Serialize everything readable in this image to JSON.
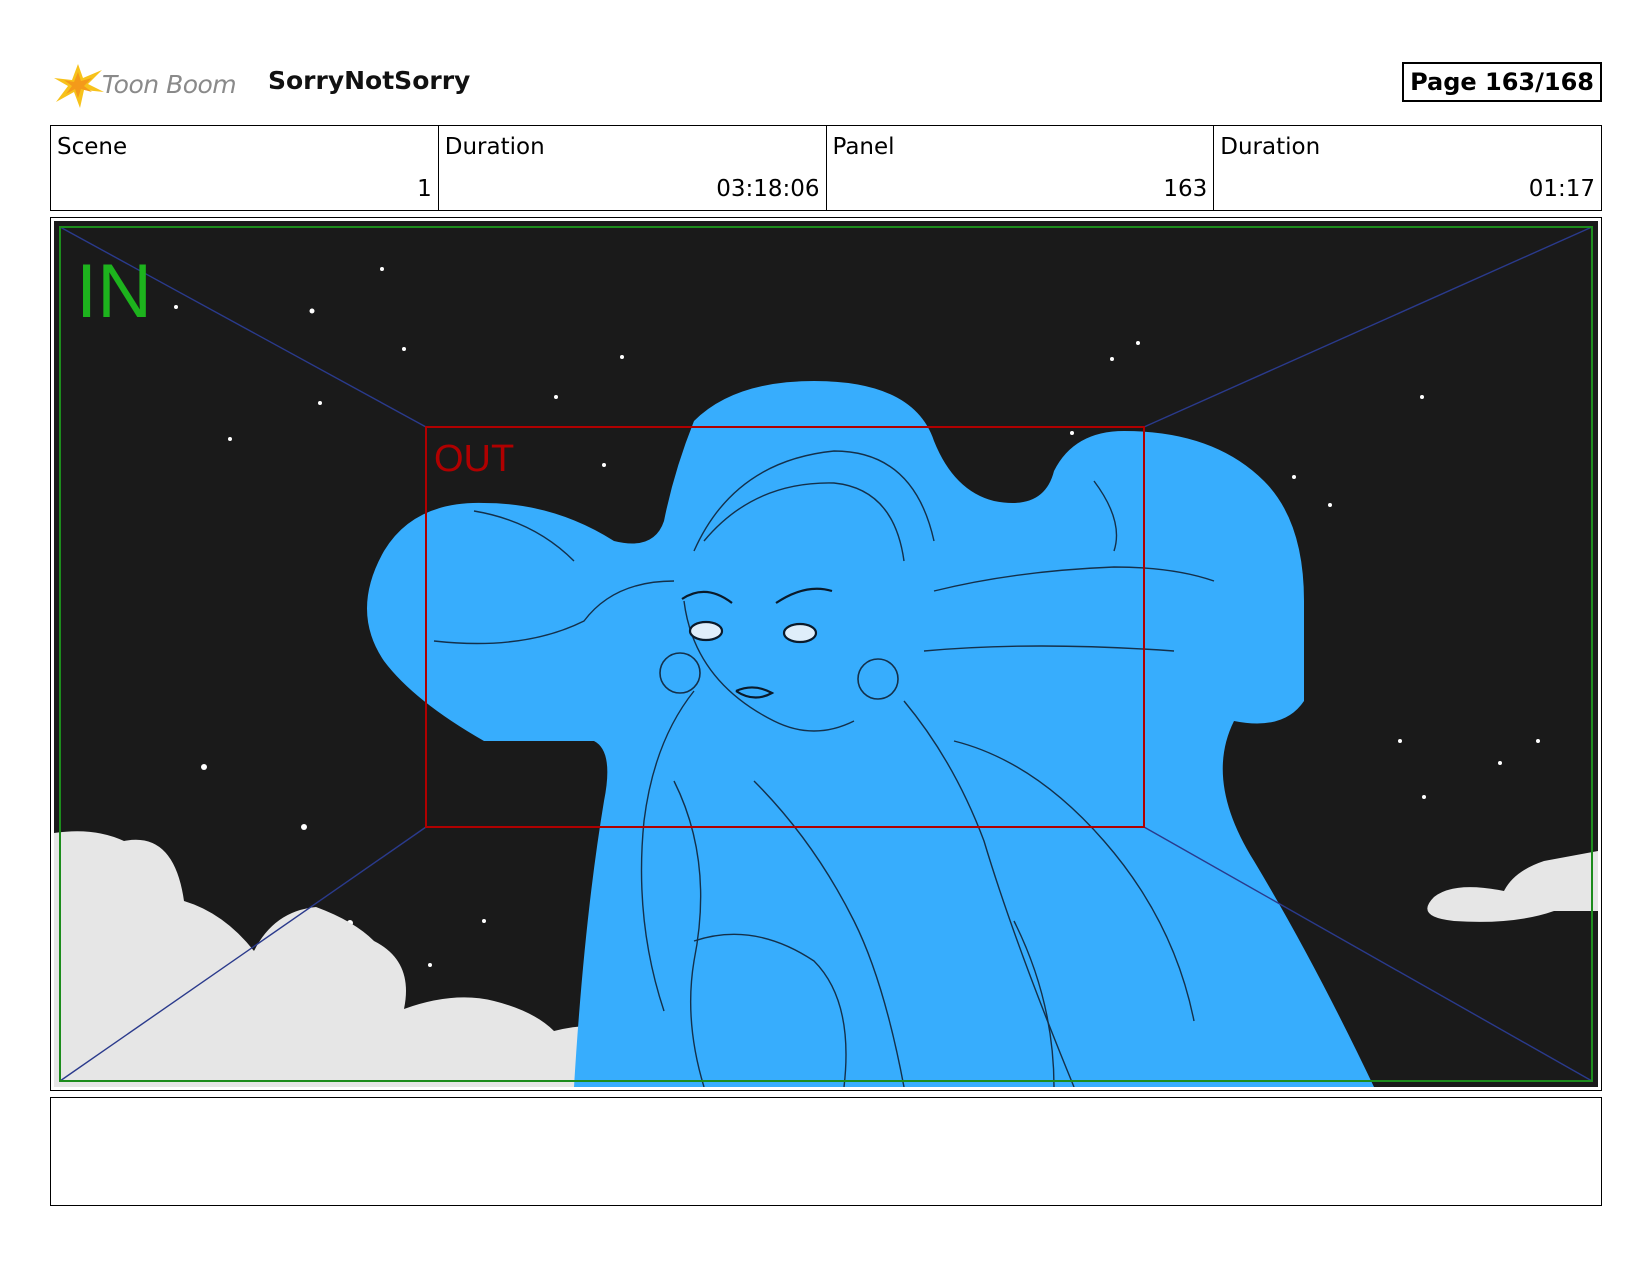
{
  "header": {
    "logo_text": "Toon Boom",
    "project": "SorryNotSorry",
    "page": "Page 163/168"
  },
  "info": {
    "scene_label": "Scene",
    "scene_value": "1",
    "duration_label": "Duration",
    "duration_value": "03:18:06",
    "panel_label": "Panel",
    "panel_value": "163",
    "panel_duration_label": "Duration",
    "panel_duration_value": "01:17"
  },
  "frame": {
    "in_label": "IN",
    "out_label": "OUT",
    "in_color": "#1db31d",
    "out_color": "#b00000",
    "figure_color": "#37adfd",
    "sky_color": "#1a1a1a",
    "cloud_color": "#e6e6e6"
  },
  "notes": {
    "text": ""
  }
}
